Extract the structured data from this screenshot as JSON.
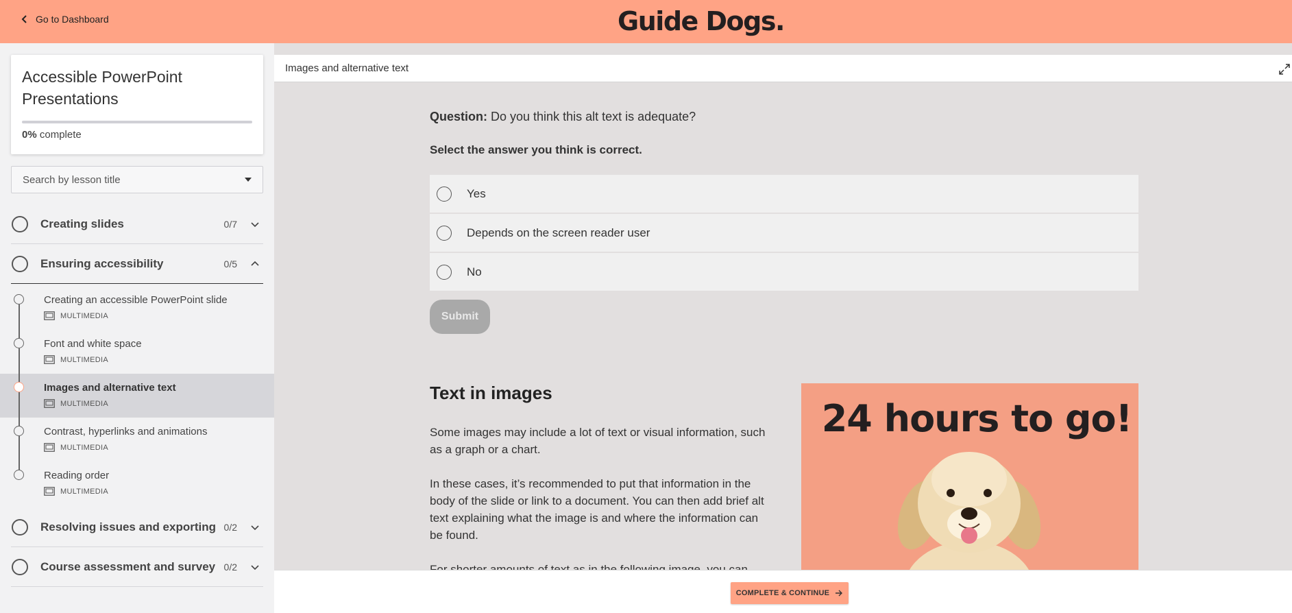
{
  "header": {
    "back_label": "Go to Dashboard",
    "brand": "Guide Dogs."
  },
  "course": {
    "title": "Accessible PowerPoint Presentations",
    "progress_value": "0%",
    "progress_suffix": "complete",
    "progress_fraction": 0
  },
  "search": {
    "placeholder": "Search by lesson title"
  },
  "sections": [
    {
      "label": "Creating slides",
      "count": "0/7",
      "expanded": false
    },
    {
      "label": "Ensuring accessibility",
      "count": "0/5",
      "expanded": true
    },
    {
      "label": "Resolving issues and exporting",
      "count": "0/2",
      "expanded": false
    },
    {
      "label": "Course assessment and survey",
      "count": "0/2",
      "expanded": false
    }
  ],
  "lessons": [
    {
      "title": "Creating an accessible PowerPoint slide",
      "type": "MULTIMEDIA"
    },
    {
      "title": "Font and white space",
      "type": "MULTIMEDIA"
    },
    {
      "title": "Images and alternative text",
      "type": "MULTIMEDIA",
      "active": true
    },
    {
      "title": "Contrast, hyperlinks and animations",
      "type": "MULTIMEDIA"
    },
    {
      "title": "Reading order",
      "type": "MULTIMEDIA"
    }
  ],
  "lesson_header": {
    "title": "Images and alternative text"
  },
  "quiz": {
    "question_label": "Question:",
    "question_text": "Do you think this alt text is adequate?",
    "instruction": "Select the answer you think is correct.",
    "options": [
      "Yes",
      "Depends on the screen reader user",
      "No"
    ],
    "submit_label": "Submit"
  },
  "content": {
    "heading": "Text in images",
    "para1": "Some images may include a lot of text or visual information, such as a graph or a chart.",
    "para2": "In these cases, it’s recommended to put that information in the body of the slide or link to a document. You can then add brief alt text explaining what the image is and where the information can be found.",
    "para3": "For shorter amounts of text as in the following image, you can",
    "image_text": "24 hours to go!"
  },
  "footer": {
    "continue_label": "COMPLETE & CONTINUE"
  },
  "colors": {
    "accent": "#ffa385",
    "image_bg": "#f49f84"
  }
}
